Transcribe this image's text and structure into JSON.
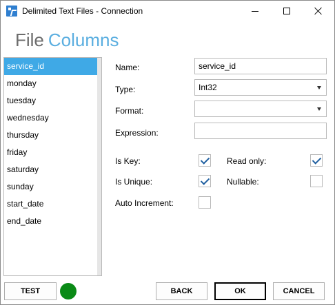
{
  "window": {
    "title": "Delimited Text Files - Connection"
  },
  "header": {
    "part1": "File",
    "part2": "Columns"
  },
  "columns": [
    {
      "label": "service_id",
      "selected": true
    },
    {
      "label": "monday"
    },
    {
      "label": "tuesday"
    },
    {
      "label": "wednesday"
    },
    {
      "label": "thursday"
    },
    {
      "label": "friday"
    },
    {
      "label": "saturday"
    },
    {
      "label": "sunday"
    },
    {
      "label": "start_date"
    },
    {
      "label": "end_date"
    }
  ],
  "form": {
    "name_label": "Name:",
    "name_value": "service_id",
    "type_label": "Type:",
    "type_value": "Int32",
    "format_label": "Format:",
    "format_value": "",
    "expression_label": "Expression:",
    "expression_value": "",
    "is_key_label": "Is Key:",
    "is_key": true,
    "read_only_label": "Read only:",
    "read_only": true,
    "is_unique_label": "Is Unique:",
    "is_unique": true,
    "nullable_label": "Nullable:",
    "nullable": false,
    "auto_increment_label": "Auto Increment:",
    "auto_increment": false
  },
  "footer": {
    "test_label": "TEST",
    "status_color": "#0a8a16",
    "back_label": "BACK",
    "ok_label": "OK",
    "cancel_label": "CANCEL"
  },
  "colors": {
    "accent": "#3fa9e6",
    "header_accent": "#5aaee0",
    "check": "#1f5fa0"
  }
}
